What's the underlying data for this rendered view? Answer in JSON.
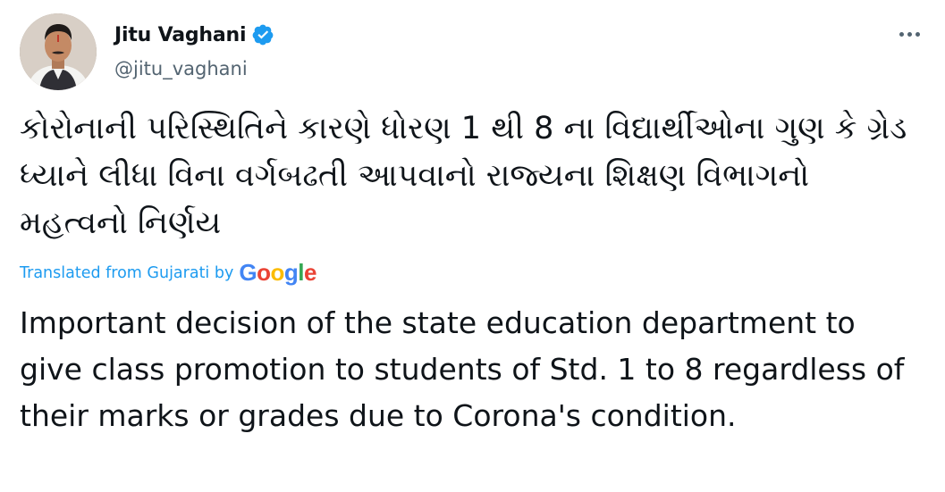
{
  "user": {
    "display_name": "Jitu Vaghani",
    "handle": "@jitu_vaghani",
    "verified": true,
    "verified_icon": "verified-badge-icon",
    "verified_color": "#1d9bf0"
  },
  "actions": {
    "more_icon": "more-horizontal-icon"
  },
  "tweet": {
    "original_text": "કોરોનાની પરિસ્થિતિને કારણે ધોરણ 1 થી 8 ના વિદ્યાર્થીઓના ગુણ કે ગ્રેડ ધ્યાને લીધા વિના વર્ગબઢતી આપવાનો રાજ્યના શિક્ષણ વિભાગનો મહત્વનો નિર્ણય",
    "translated_label": "Translated from Gujarati by",
    "translation_provider": "Google",
    "translated_text": "Important decision of the state education department to give class promotion to students of Std. 1 to 8 regardless of their marks or grades due to Corona's condition."
  },
  "colors": {
    "text_primary": "#0f1419",
    "text_secondary": "#536471",
    "accent": "#1d9bf0"
  }
}
